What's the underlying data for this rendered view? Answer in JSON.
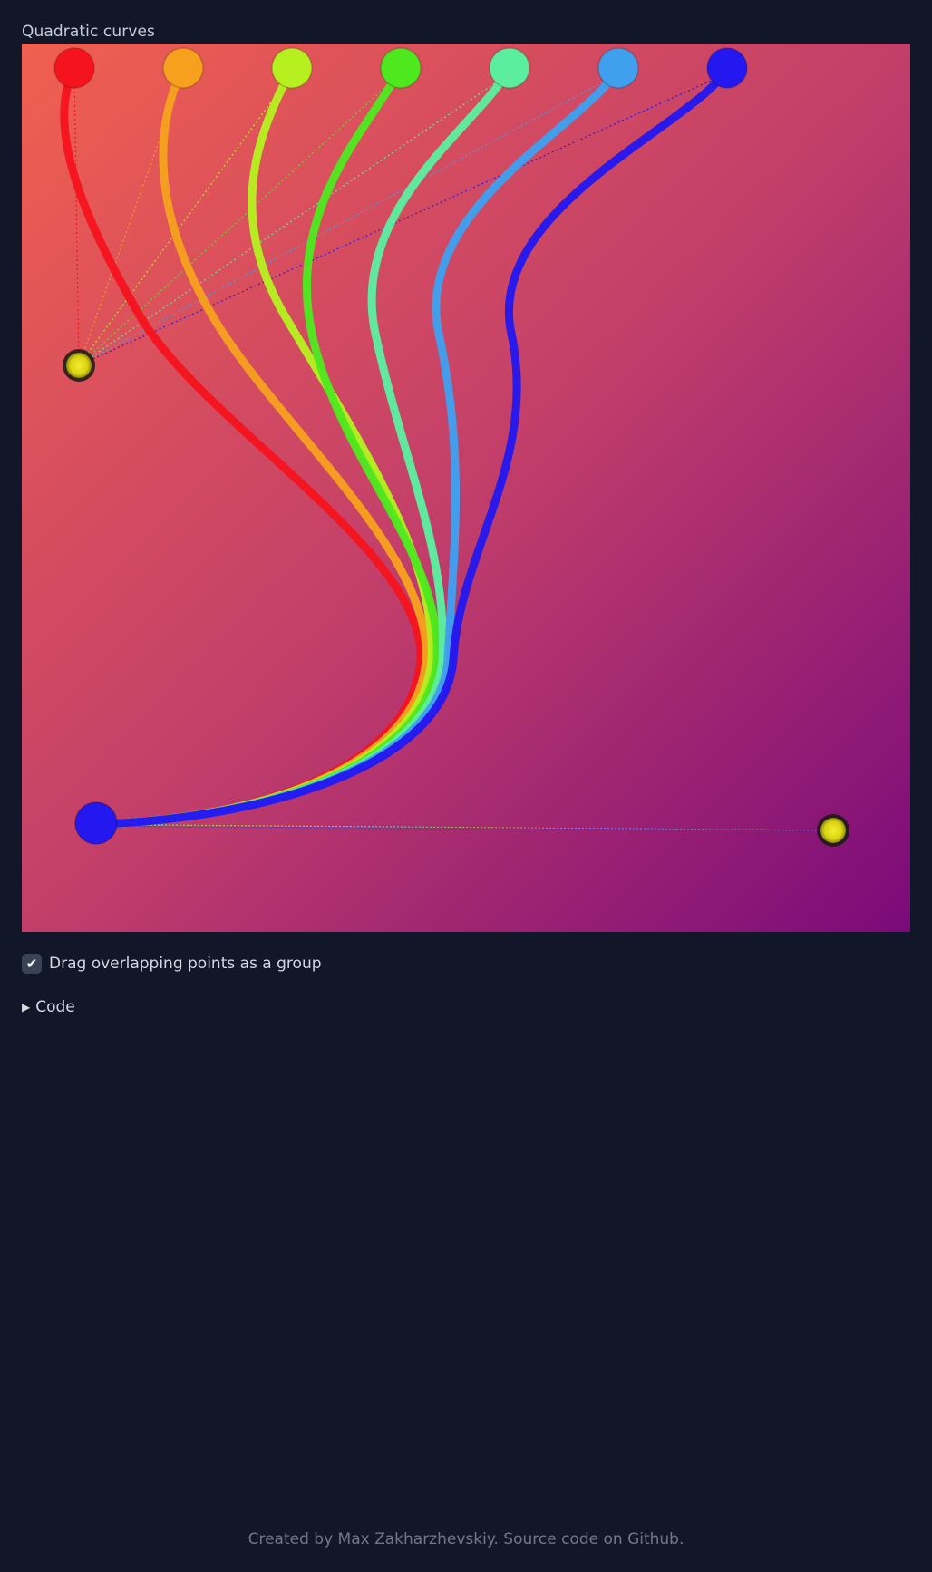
{
  "title": "Quadratic curves",
  "checkbox": {
    "label": "Drag overlapping points as a group",
    "checked": true,
    "check_glyph": "✔"
  },
  "code_toggle": {
    "label": "Code",
    "icon": "triangle-right-icon"
  },
  "footer": {
    "prefix": "Created by ",
    "author": "Max Zakharzhevskiy",
    "middle": ". Source code on ",
    "link": "Github",
    "suffix": "."
  },
  "colors": {
    "page_background": "#111729",
    "canvas_gradient": [
      "#f0604f",
      "#c33f6a",
      "#7a0a7a"
    ],
    "control_point_fill": "#e8e21a",
    "control_point_ring": "#1a1a14",
    "curves": [
      "#f5141e",
      "#f6a01e",
      "#b6f01e",
      "#4ee81e",
      "#5ceea0",
      "#3fa0ee",
      "#2418f0"
    ]
  }
}
